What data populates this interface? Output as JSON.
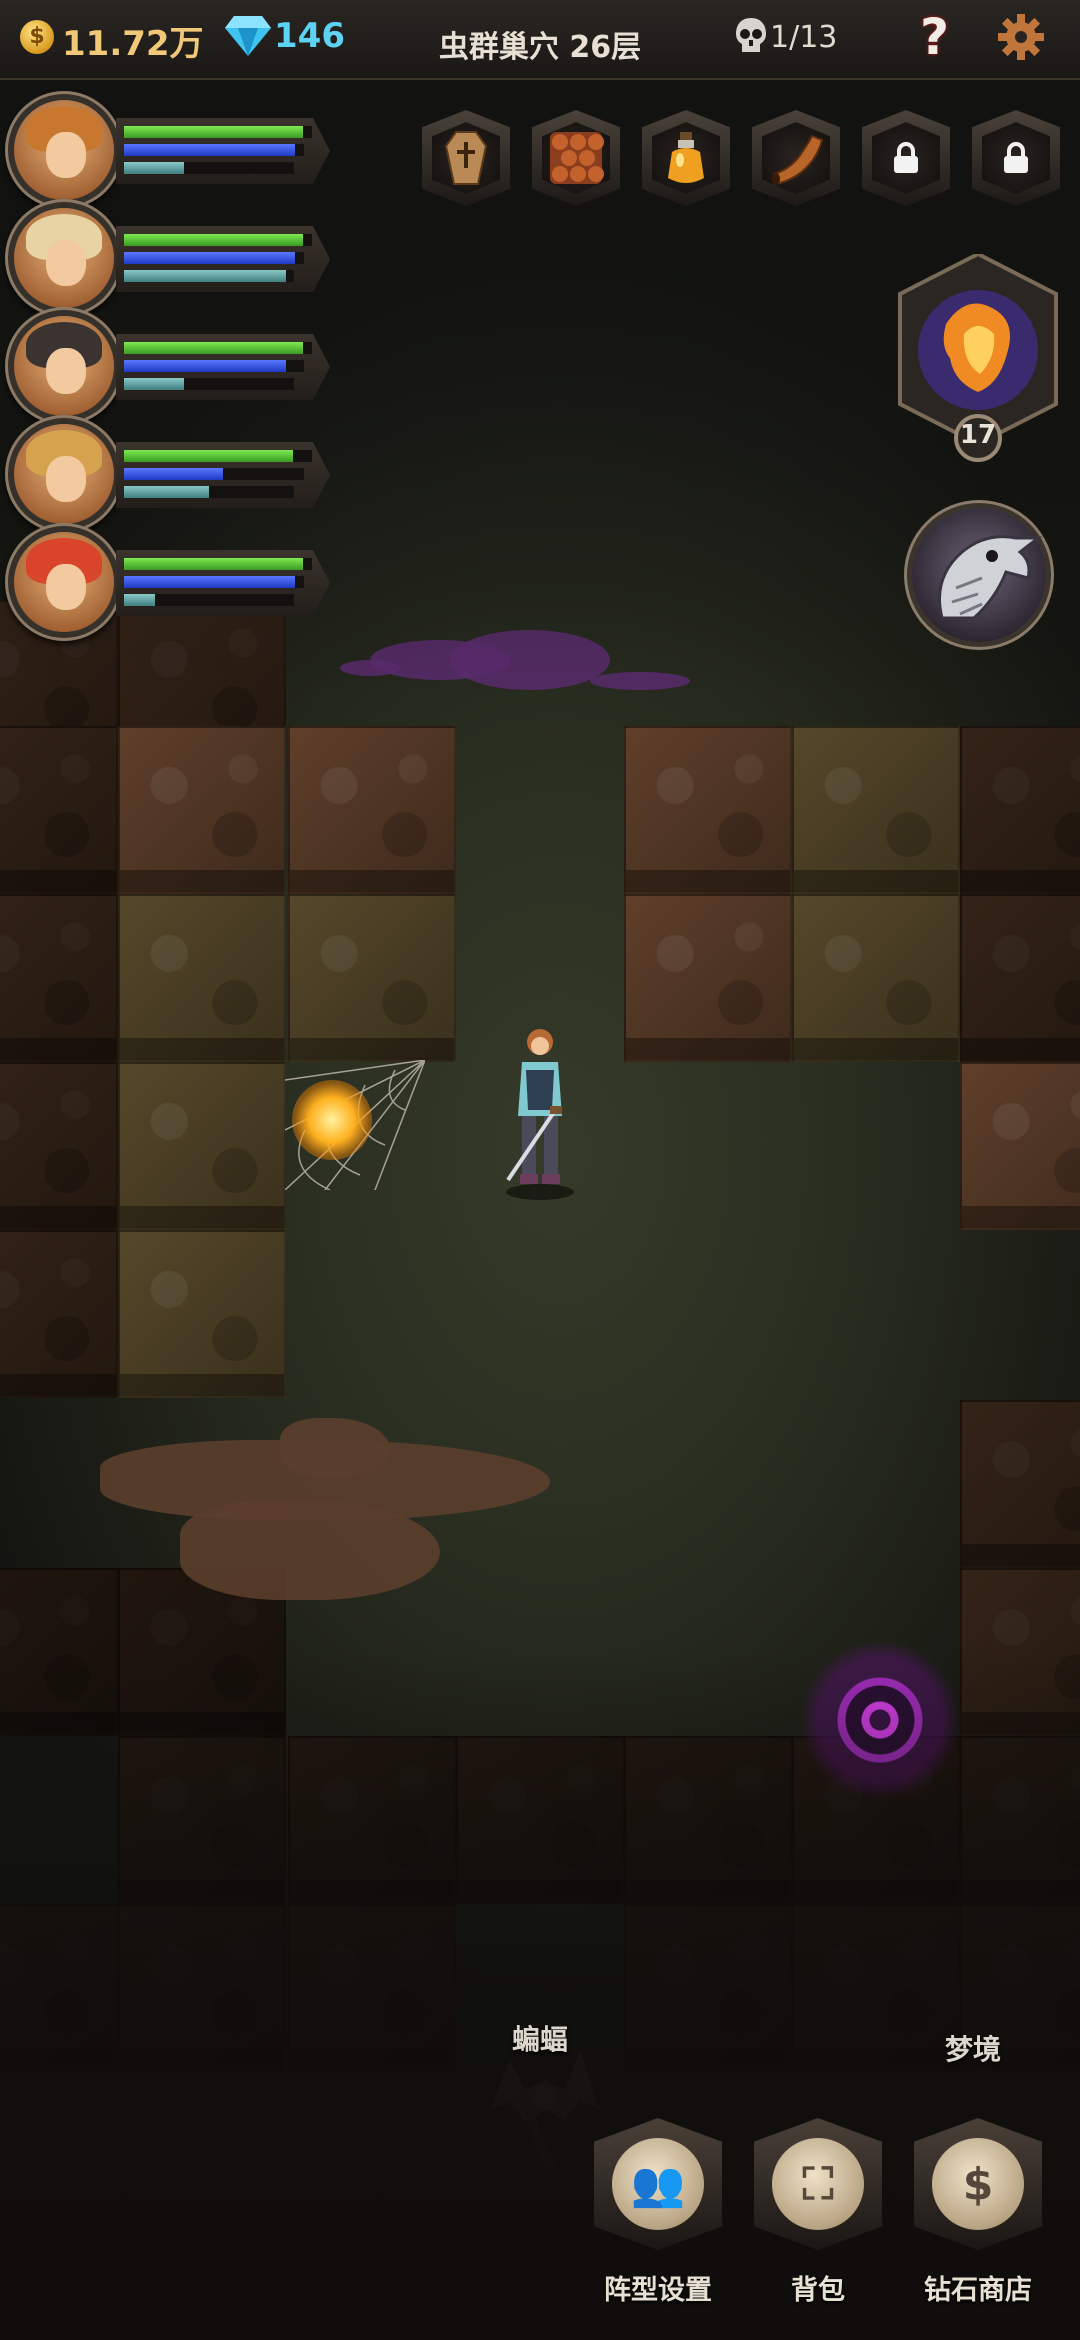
{
  "topbar": {
    "gold_icon_symbol": "$",
    "gold": "11.72万",
    "gems": "146",
    "location": "虫群巢穴 26层",
    "kills": "1/13",
    "help_label": "?",
    "icons": {
      "gold": "gold-coin-icon",
      "gem": "diamond-gem-icon",
      "kills": "skull-icon",
      "settings": "gear-icon"
    }
  },
  "party": [
    {
      "name": "hero-1",
      "hp": 0.95,
      "mp": 0.95,
      "xp": 0.35,
      "hair": "#c7772e"
    },
    {
      "name": "hero-2",
      "hp": 0.95,
      "mp": 0.95,
      "xp": 0.95,
      "hair": "#e8d3a4"
    },
    {
      "name": "hero-3",
      "hp": 0.95,
      "mp": 0.9,
      "xp": 0.35,
      "hair": "#3a3330"
    },
    {
      "name": "hero-4",
      "hp": 0.9,
      "mp": 0.55,
      "xp": 0.5,
      "hair": "#d5a24e"
    },
    {
      "name": "hero-5",
      "hp": 0.95,
      "mp": 0.95,
      "xp": 0.18,
      "hair": "#d8452a"
    }
  ],
  "item_slots": [
    {
      "icon": "coffin-icon",
      "locked": false
    },
    {
      "icon": "dragon-scale-icon",
      "locked": false
    },
    {
      "icon": "potion-bottle-icon",
      "locked": false
    },
    {
      "icon": "horn-icon",
      "locked": false
    },
    {
      "icon": "lock-icon",
      "locked": true
    },
    {
      "icon": "lock-icon",
      "locked": true
    }
  ],
  "skills": {
    "fire_skill_count": "17",
    "fire_skill_icon": "fire-dancer-icon",
    "bird_skill_icon": "bird-skull-icon"
  },
  "map": {
    "enemy_label": "蝙蝠",
    "portal_label": "梦境"
  },
  "bottom_buttons": [
    {
      "label": "阵型设置",
      "icon": "party-formation-icon",
      "glyph": "👥"
    },
    {
      "label": "背包",
      "icon": "backpack-icon",
      "glyph": "⛶"
    },
    {
      "label": "钻石商店",
      "icon": "diamond-shop-icon",
      "glyph": "$"
    }
  ],
  "colors": {
    "gold_text": "#f0c877",
    "gem_text": "#5cd3f2",
    "hp": "#5ccf3a",
    "mp": "#3452e6",
    "xp": "#6aa7a8",
    "portal": "#c43ad8"
  }
}
